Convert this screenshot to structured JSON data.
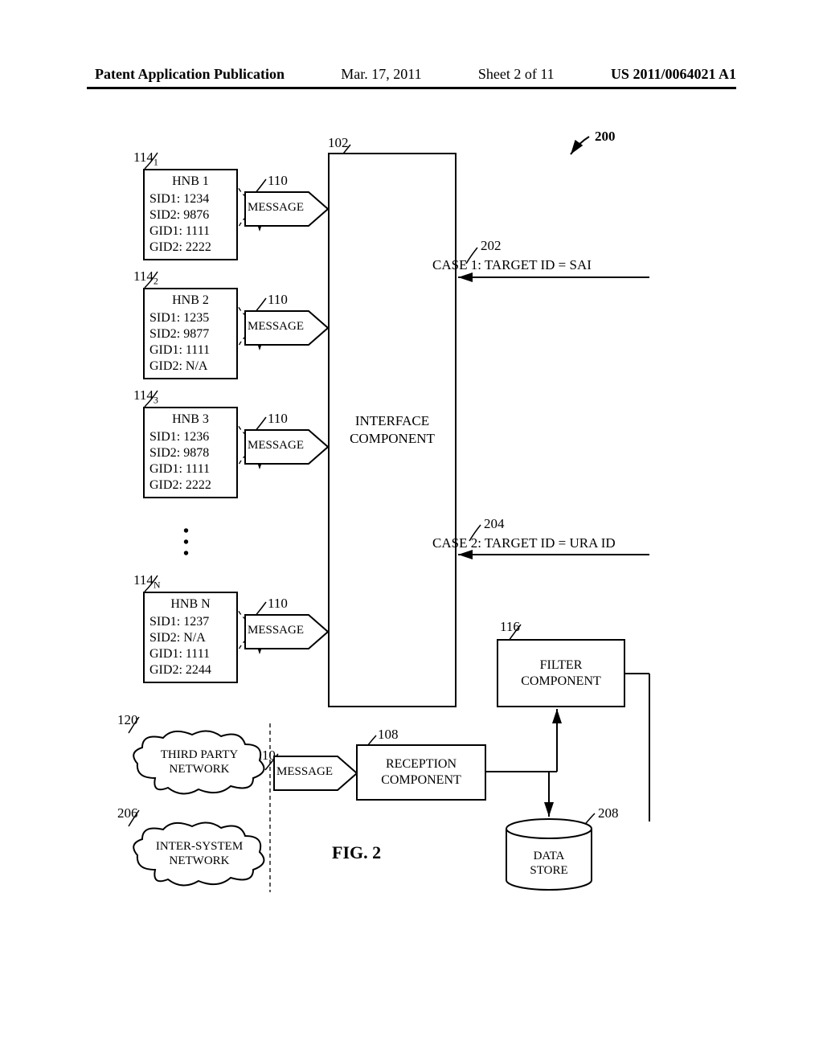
{
  "header": {
    "publication_label": "Patent Application Publication",
    "date": "Mar. 17, 2011",
    "sheet": "Sheet 2 of 11",
    "pub_number": "US 2011/0064021 A1"
  },
  "figure_ref": "200",
  "figure_caption": "FIG. 2",
  "interface_component": {
    "ref": "102",
    "label": "INTERFACE\nCOMPONENT"
  },
  "filter_component": {
    "ref": "116",
    "label": "FILTER\nCOMPONENT"
  },
  "reception_component": {
    "ref": "108",
    "label": "RECEPTION\nCOMPONENT"
  },
  "data_store": {
    "ref": "208",
    "label": "DATA\nSTORE"
  },
  "cases": {
    "case1": {
      "ref": "202",
      "text": "CASE 1: TARGET ID = SAI"
    },
    "case2": {
      "ref": "204",
      "text": "CASE 2: TARGET ID = URA ID"
    }
  },
  "message_label": "MESSAGE",
  "message_ref": "110",
  "hnbs": [
    {
      "ref": "114",
      "ref_sub": "1",
      "title": "HNB 1",
      "SID1": "1234",
      "SID2": "9876",
      "GID1": "1111",
      "GID2": "2222"
    },
    {
      "ref": "114",
      "ref_sub": "2",
      "title": "HNB 2",
      "SID1": "1235",
      "SID2": "9877",
      "GID1": "1111",
      "GID2": "N/A"
    },
    {
      "ref": "114",
      "ref_sub": "3",
      "title": "HNB 3",
      "SID1": "1236",
      "SID2": "9878",
      "GID1": "1111",
      "GID2": "2222"
    },
    {
      "ref": "114",
      "ref_sub": "N",
      "title": "HNB N",
      "SID1": "1237",
      "SID2": "N/A",
      "GID1": "1111",
      "GID2": "2244"
    }
  ],
  "clouds": {
    "third_party": {
      "ref": "120",
      "label": "THIRD PARTY\nNETWORK"
    },
    "inter_system": {
      "ref": "206",
      "label": "INTER-SYSTEM\nNETWORK"
    }
  }
}
